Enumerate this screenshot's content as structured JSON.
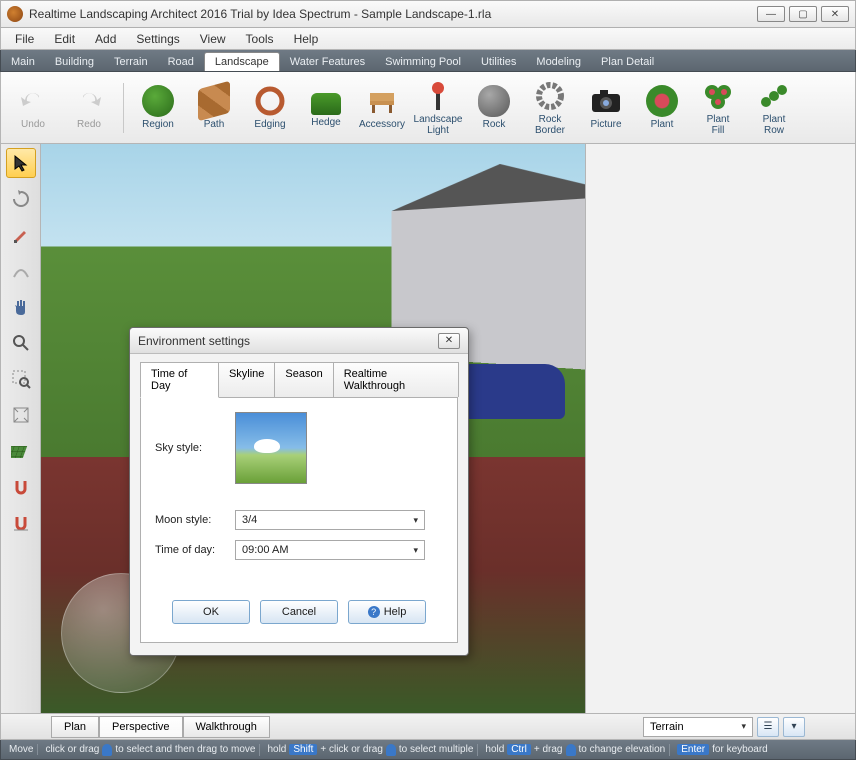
{
  "window": {
    "title": "Realtime Landscaping Architect 2016 Trial by Idea Spectrum - Sample Landscape-1.rla"
  },
  "menu": [
    "File",
    "Edit",
    "Add",
    "Settings",
    "View",
    "Tools",
    "Help"
  ],
  "ribbon_tabs": [
    "Main",
    "Building",
    "Terrain",
    "Road",
    "Landscape",
    "Water Features",
    "Swimming Pool",
    "Utilities",
    "Modeling",
    "Plan Detail"
  ],
  "ribbon_active": "Landscape",
  "tools": {
    "undo": "Undo",
    "redo": "Redo",
    "region": "Region",
    "path": "Path",
    "edging": "Edging",
    "hedge": "Hedge",
    "accessory": "Accessory",
    "landscape_light": "Landscape\nLight",
    "rock": "Rock",
    "rock_border": "Rock\nBorder",
    "picture": "Picture",
    "plant": "Plant",
    "plant_fill": "Plant\nFill",
    "plant_row": "Plant\nRow"
  },
  "view_tabs": {
    "plan": "Plan",
    "perspective": "Perspective",
    "walkthrough": "Walkthrough"
  },
  "view_active": "Perspective",
  "terrain_dropdown": "Terrain",
  "status": {
    "mode": "Move",
    "hint1": "click or drag",
    "hint1b": "to select and then drag to move",
    "hint2": "hold",
    "shift": "Shift",
    "hint2b": "+ click or drag",
    "hint2c": "to select multiple",
    "ctrl": "Ctrl",
    "hint3b": "+ drag",
    "hint3c": "to change elevation",
    "enter": "Enter",
    "hint4": "for keyboard"
  },
  "dialog": {
    "title": "Environment settings",
    "tabs": [
      "Time of Day",
      "Skyline",
      "Season",
      "Realtime Walkthrough"
    ],
    "active_tab": "Time of Day",
    "sky_label": "Sky style:",
    "moon_label": "Moon style:",
    "moon_value": "3/4",
    "time_label": "Time of day:",
    "time_value": "09:00 AM",
    "ok": "OK",
    "cancel": "Cancel",
    "help": "Help"
  }
}
